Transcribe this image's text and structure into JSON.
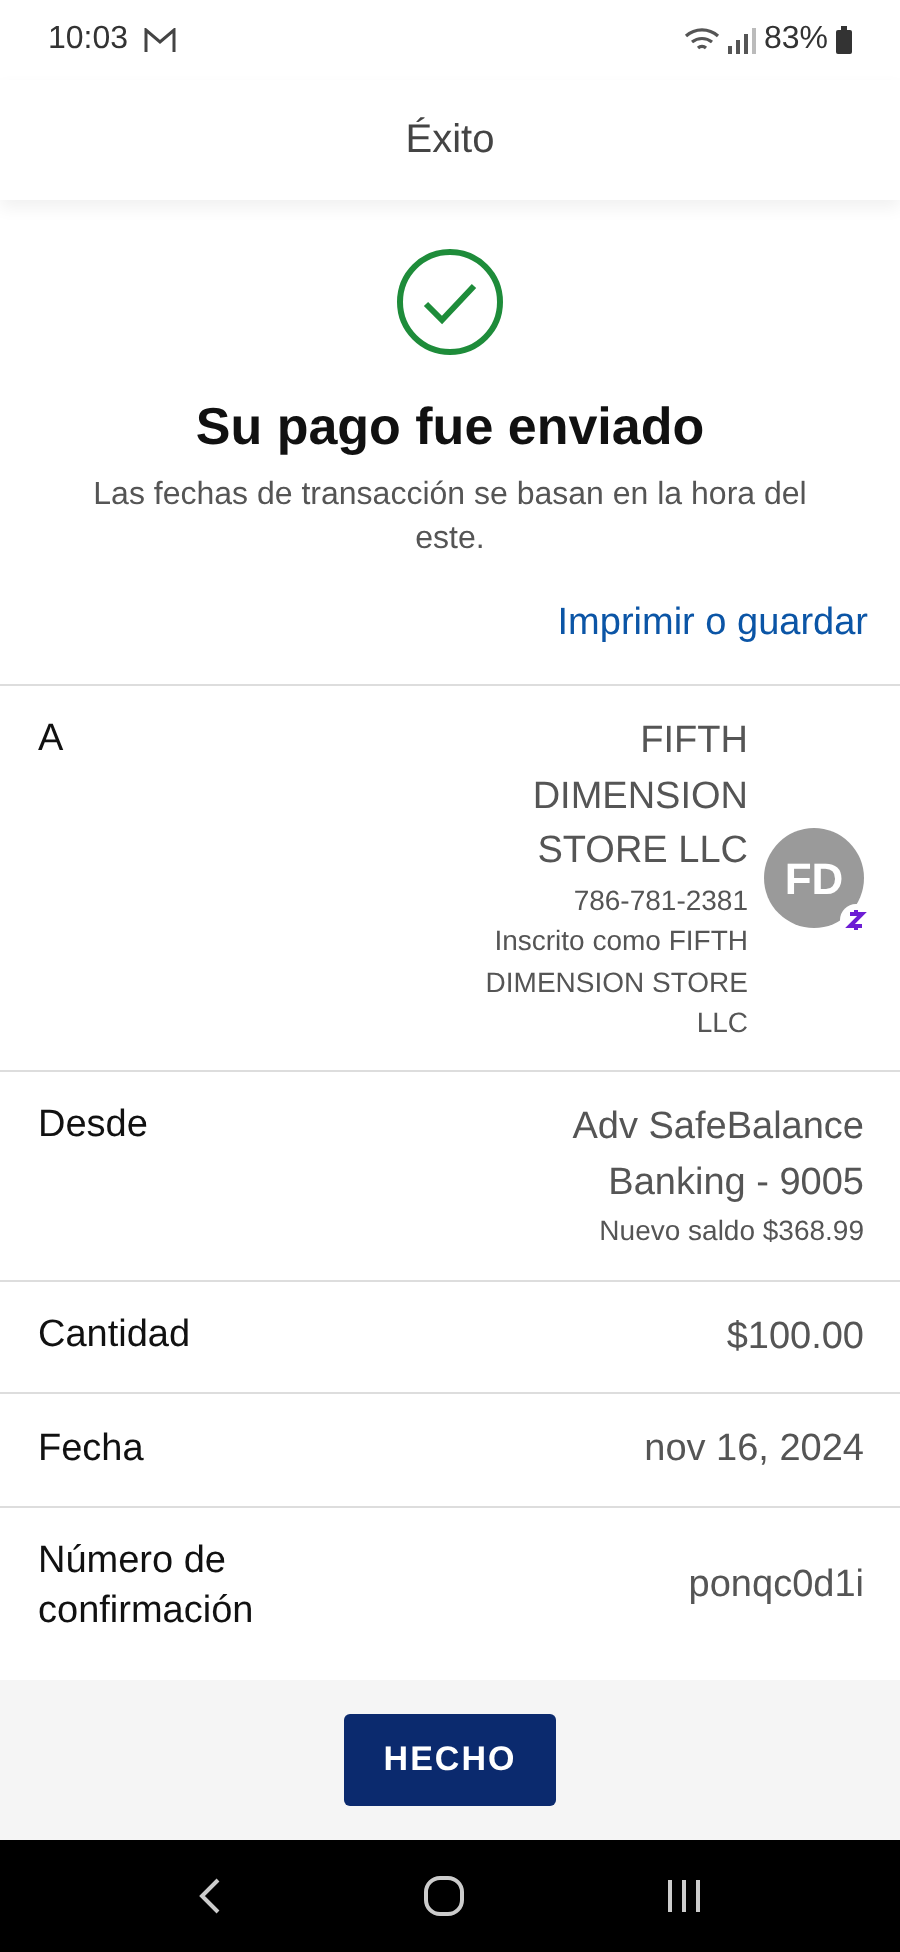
{
  "status_bar": {
    "time": "10:03",
    "battery": "83%"
  },
  "header": {
    "title": "Éxito"
  },
  "confirmation": {
    "title": "Su pago fue enviado",
    "note": "Las fechas de transacción se basan en la hora del este.",
    "link": "Imprimir o guardar"
  },
  "details": [
    {
      "kind": "recipient",
      "label": "A",
      "name": "FIFTH DIMENSION STORE LLC",
      "phone": "786-781-2381",
      "enrolled": "Inscrito como FIFTH DIMENSION STORE LLC",
      "avatar": "FD"
    },
    {
      "kind": "account",
      "label": "Desde",
      "value": "Adv SafeBalance Banking - 9005",
      "sub": "Nuevo saldo $368.99"
    },
    {
      "kind": "simple",
      "label": "Cantidad",
      "value": "$100.00"
    },
    {
      "kind": "simple",
      "label": "Fecha",
      "value": "nov 16, 2024"
    },
    {
      "kind": "simple",
      "label": "Número de confirmación",
      "value": "ponqc0d1i"
    }
  ],
  "footer": {
    "button": "HECHO"
  }
}
